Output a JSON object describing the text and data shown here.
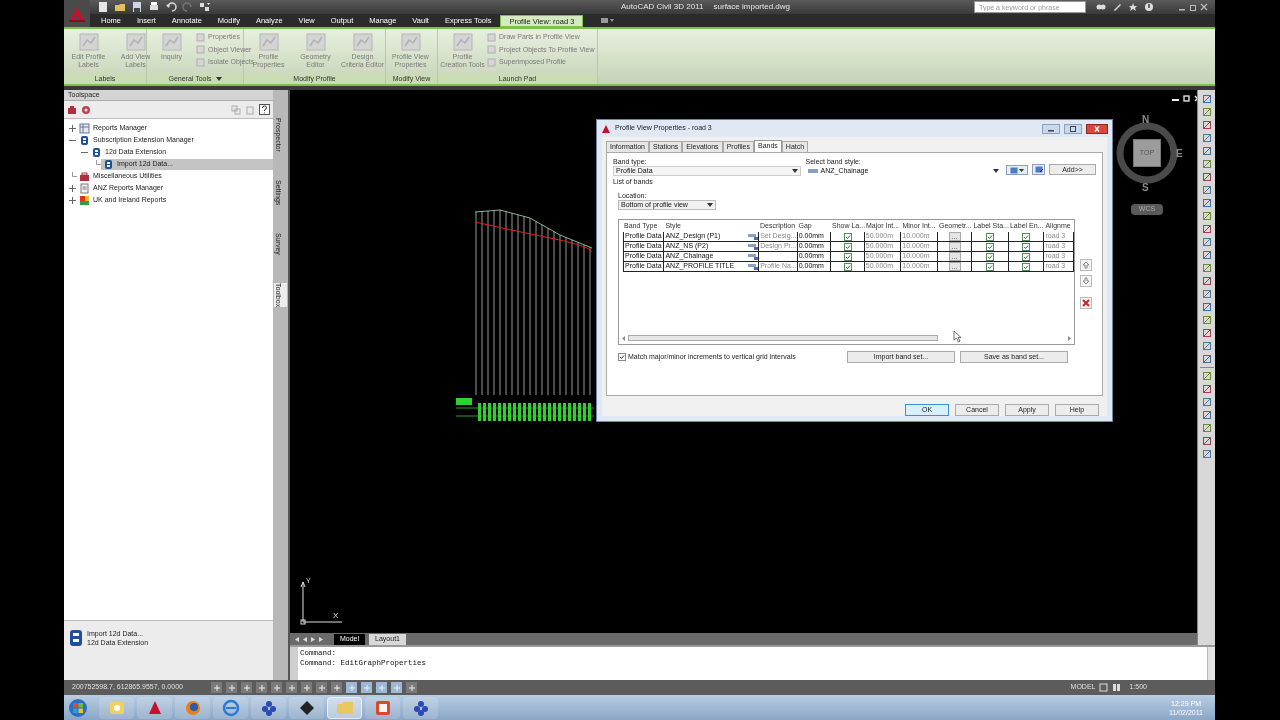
{
  "title_bar": {
    "app_name": "AutoCAD Civil 3D 2011",
    "file_name": "surface imported.dwg",
    "search": {
      "placeholder": "Type a keyword or phrase"
    }
  },
  "ribbon_tabs": [
    {
      "label": "Home",
      "selected": false
    },
    {
      "label": "Insert",
      "selected": false
    },
    {
      "label": "Annotate",
      "selected": false
    },
    {
      "label": "Modify",
      "selected": false
    },
    {
      "label": "Analyze",
      "selected": false
    },
    {
      "label": "View",
      "selected": false
    },
    {
      "label": "Output",
      "selected": false
    },
    {
      "label": "Manage",
      "selected": false
    },
    {
      "label": "Vault",
      "selected": false
    },
    {
      "label": "Express Tools",
      "selected": false
    },
    {
      "label": "Profile View: road 3",
      "selected": true
    }
  ],
  "ribbon_panels": [
    {
      "title": "Labels",
      "has_menu": false,
      "tools": [
        {
          "kind": "large",
          "label": "Edit Profile Labels"
        },
        {
          "kind": "large",
          "label": "Add View Labels"
        }
      ]
    },
    {
      "title": "General Tools",
      "has_menu": true,
      "tools": [
        {
          "kind": "large",
          "label": "Inquiry"
        },
        {
          "kind": "small",
          "label": "Properties"
        },
        {
          "kind": "small",
          "label": "Object Viewer"
        },
        {
          "kind": "small",
          "label": "Isolate Objects"
        }
      ]
    },
    {
      "title": "Modify Profile",
      "has_menu": false,
      "tools": [
        {
          "kind": "large",
          "label": "Profile Properties"
        },
        {
          "kind": "large",
          "label": "Geometry Editor"
        },
        {
          "kind": "large",
          "label": "Design Criteria Editor"
        }
      ]
    },
    {
      "title": "Modify View",
      "has_menu": false,
      "tools": [
        {
          "kind": "large",
          "label": "Profile View Properties"
        }
      ]
    },
    {
      "title": "Launch Pad",
      "has_menu": false,
      "tools": [
        {
          "kind": "large",
          "label": "Profile Creation Tools"
        },
        {
          "kind": "small",
          "label": "Draw Parts in Profile View"
        },
        {
          "kind": "small",
          "label": "Project Objects To Profile View"
        },
        {
          "kind": "small",
          "label": "Superimposed Profile"
        }
      ]
    }
  ],
  "toolspace": {
    "title": "Toolspace",
    "tree": [
      {
        "label": "Reports Manager",
        "kind": "report",
        "expanded": false,
        "selected": false
      },
      {
        "label": "Subscription Extension Manager",
        "kind": "extension",
        "expanded": true,
        "selected": false,
        "children": [
          {
            "label": "12d Data Extension",
            "kind": "extension",
            "expanded": true,
            "selected": false,
            "children": [
              {
                "label": "Import 12d Data...",
                "kind": "extension",
                "selected": true
              }
            ]
          }
        ]
      },
      {
        "label": "Miscellaneous Utilities",
        "kind": "toolbox",
        "selected": false
      },
      {
        "label": "ANZ Reports Manager",
        "kind": "document",
        "expanded": false,
        "selected": false
      },
      {
        "label": "UK and Ireland Reports",
        "kind": "flag",
        "expanded": false,
        "selected": false
      }
    ],
    "side_tabs": [
      {
        "label": "Prospector",
        "selected": false
      },
      {
        "label": "Settings",
        "selected": false
      },
      {
        "label": "Survey",
        "selected": false
      },
      {
        "label": "Toolbox",
        "selected": true
      }
    ],
    "item_details": {
      "title": "Import 12d Data...",
      "subtitle": "12d Data Extension"
    }
  },
  "canvas": {
    "ucs_icon": {
      "x_label": "X",
      "y_label": "Y"
    },
    "viewcube": {
      "north": "N",
      "east": "E",
      "south": "S",
      "face": "TOP",
      "ucs": "WCS"
    },
    "layout_tabs": [
      {
        "label": "Model",
        "selected": true
      },
      {
        "label": "Layout1",
        "selected": false
      }
    ]
  },
  "dialog": {
    "title": "Profile View Properties - road 3",
    "tabs": [
      {
        "label": "Information",
        "selected": false
      },
      {
        "label": "Stations",
        "selected": false
      },
      {
        "label": "Elevations",
        "selected": false
      },
      {
        "label": "Profiles",
        "selected": false
      },
      {
        "label": "Bands",
        "selected": true
      },
      {
        "label": "Hatch",
        "selected": false
      }
    ],
    "band_type": {
      "label": "Band type:",
      "value": "Profile Data"
    },
    "band_style": {
      "label": "Select band style:",
      "value": "ANZ_Chainage"
    },
    "add_button": "Add>>",
    "list_label": "List of bands",
    "location": {
      "label": "Location:",
      "value": "Bottom of profile view"
    },
    "columns": [
      "Band Type",
      "Style",
      "Description",
      "Gap",
      "Show La...",
      "Major Int...",
      "Minor Int...",
      "Geometr...",
      "Label Sta...",
      "Label En...",
      "Alignme"
    ],
    "bands": [
      {
        "band_type": "Profile Data",
        "style": "ANZ_Design (P1)",
        "description": "Set Desig...",
        "gap": "0.00mm",
        "show_labels": true,
        "major_interval": "50.000m",
        "minor_interval": "10.000m",
        "geometry": "...",
        "label_start": true,
        "label_end": true,
        "alignment": "road 3"
      },
      {
        "band_type": "Profile Data",
        "style": "ANZ_NS (P2)",
        "description": "Design Pr...",
        "gap": "0.00mm",
        "show_labels": true,
        "major_interval": "50.000m",
        "minor_interval": "10.000m",
        "geometry": "...",
        "label_start": true,
        "label_end": true,
        "alignment": "road 3"
      },
      {
        "band_type": "Profile Data",
        "style": "ANZ_Chainage",
        "gap": "0.00mm",
        "show_labels": true,
        "major_interval": "50.000m",
        "minor_interval": "10.000m",
        "geometry": "...",
        "label_start": true,
        "label_end": true,
        "alignment": "road 3"
      },
      {
        "band_type": "Profile Data",
        "style": "ANZ_PROFILE TITLE",
        "description": "Profile Na...",
        "gap": "0.00mm",
        "show_labels": true,
        "major_interval": "50.000m",
        "minor_interval": "10.000m",
        "geometry": "...",
        "label_start": true,
        "label_end": true,
        "alignment": "road 3"
      }
    ],
    "match_increments": {
      "label": "Match major/minor increments to vertical grid intervals",
      "checked": true
    },
    "band_set_buttons": [
      "Import band set...",
      "Save as band set..."
    ],
    "buttons": [
      {
        "label": "OK",
        "default": true
      },
      {
        "label": "Cancel",
        "default": false
      },
      {
        "label": "Apply",
        "default": false
      },
      {
        "label": "Help",
        "default": false
      }
    ]
  },
  "command_line": {
    "history": [
      "Command:",
      "Command: EditGraphProperties"
    ]
  },
  "status_bar": {
    "coordinates": "200752598.7, 612865.9557, 0.0000",
    "space": "MODEL",
    "scale": "1:500"
  },
  "taskbar": {
    "time": "12:29 PM",
    "date": "11/02/2011"
  }
}
